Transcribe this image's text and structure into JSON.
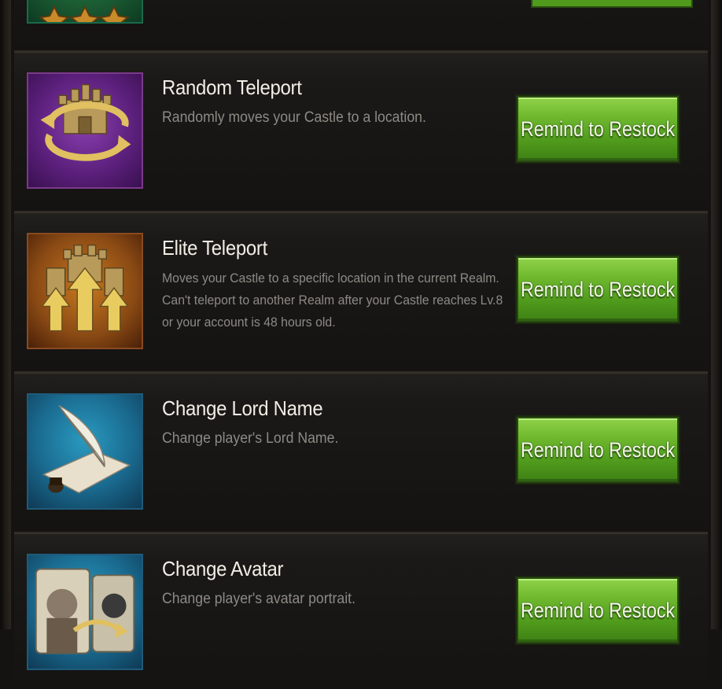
{
  "items": [
    {
      "title": "Random Teleport",
      "description": "Randomly moves your Castle to a location.",
      "button_label": "Remind to Restock",
      "icon": "random-teleport-icon",
      "icon_color": "#6b2a8a"
    },
    {
      "title": "Elite Teleport",
      "description": "Moves your Castle to a specific location in the current Realm. Can't teleport to another Realm after your Castle reaches Lv.8 or your account is 48 hours old.",
      "button_label": "Remind to Restock",
      "icon": "elite-teleport-icon",
      "icon_color": "#8a4a14"
    },
    {
      "title": "Change Lord Name",
      "description": "Change player's Lord Name.",
      "button_label": "Remind to Restock",
      "icon": "quill-icon",
      "icon_color": "#1f6f8f"
    },
    {
      "title": "Change Avatar",
      "description": "Change player's avatar portrait.",
      "button_label": "Remind to Restock",
      "icon": "avatar-swap-icon",
      "icon_color": "#1f6f8f"
    }
  ],
  "colors": {
    "button_green": "#6fb92e",
    "background": "#141312",
    "title_text": "#f2eee6",
    "desc_text": "#8d8a84"
  }
}
